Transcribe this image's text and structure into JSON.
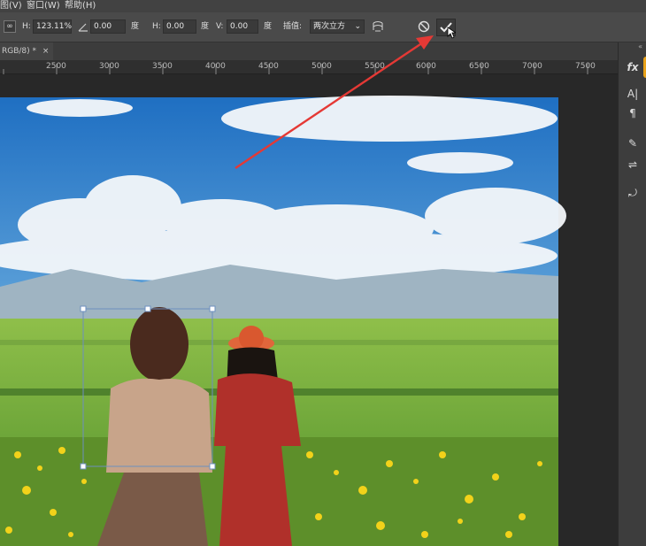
{
  "menu": [
    "图(V)",
    "窗口(W)",
    "帮助(H)"
  ],
  "options": {
    "h_label": "H:",
    "h_value": "123.11%",
    "angle_value": "0.00",
    "angle_unit": "度",
    "hskew_label": "H:",
    "hskew_value": "0.00",
    "hskew_unit": "度",
    "vskew_label": "V:",
    "vskew_value": "0.00",
    "vskew_unit": "度",
    "interp_label": "插值:",
    "interp_value": "两次立方"
  },
  "doc_tab": {
    "title": "RGB/8) *",
    "close": "×"
  },
  "ruler_ticks": [
    "2500",
    "3000",
    "3500",
    "4000",
    "4500",
    "5000",
    "5500",
    "6000",
    "6500",
    "7000",
    "7500"
  ],
  "right_tools": [
    {
      "icon": "fx-icon",
      "glyph": "fx"
    },
    {
      "icon": "character-icon",
      "glyph": "A|"
    },
    {
      "icon": "paragraph-icon",
      "glyph": "¶"
    },
    {
      "icon": "brush-settings-icon",
      "glyph": "✎"
    },
    {
      "icon": "adjustments-icon",
      "glyph": "⇌"
    },
    {
      "icon": "clone-source-icon",
      "glyph": "⤾"
    }
  ],
  "colors": {
    "accent_arrow": "#e53935",
    "selection": "#6d8fbf"
  }
}
